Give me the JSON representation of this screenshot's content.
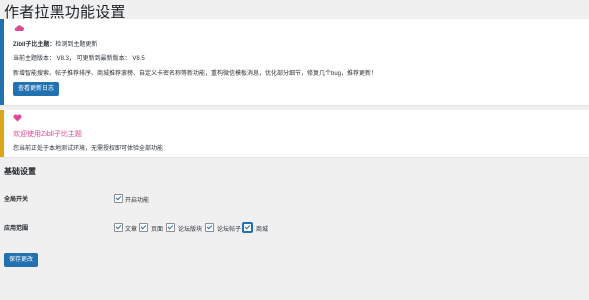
{
  "page": {
    "title": "作者拉黑功能设置"
  },
  "update_notice": {
    "icon": "cloud-icon",
    "theme_label": "Zibll子比主题：",
    "theme_status": "检测到主题更新",
    "version_line": "当前主题版本：  V8.3，  可更新到最新版本：  V8.5",
    "changelog": "新增智能搜索、帖子推荐排序、商城推荐滚榜、自定义卡密名称等新功能，重构微信模板消息，优化部分细节，修复几个bug，推荐更新！",
    "button_label": "查看更新日志",
    "accent_color": "#2271b1"
  },
  "welcome_notice": {
    "icon": "heart-icon",
    "title": "欢迎使用Zibll子比主题",
    "description": "您当前正处于本地测试环境，无需授权即可体验全部功能",
    "title_color": "#e04796",
    "border_color": "#dba617"
  },
  "settings": {
    "section_title": "基础设置",
    "global_switch": {
      "label": "全局开关",
      "option": "开启功能",
      "checked": true
    },
    "scope": {
      "label": "应用范围",
      "options": [
        {
          "label": "文章",
          "checked": true
        },
        {
          "label": "页面",
          "checked": true
        },
        {
          "label": "论坛版块",
          "checked": true
        },
        {
          "label": "论坛帖子",
          "checked": true
        },
        {
          "label": "商城",
          "checked": true
        }
      ]
    }
  },
  "save_button_label": "保存更改"
}
